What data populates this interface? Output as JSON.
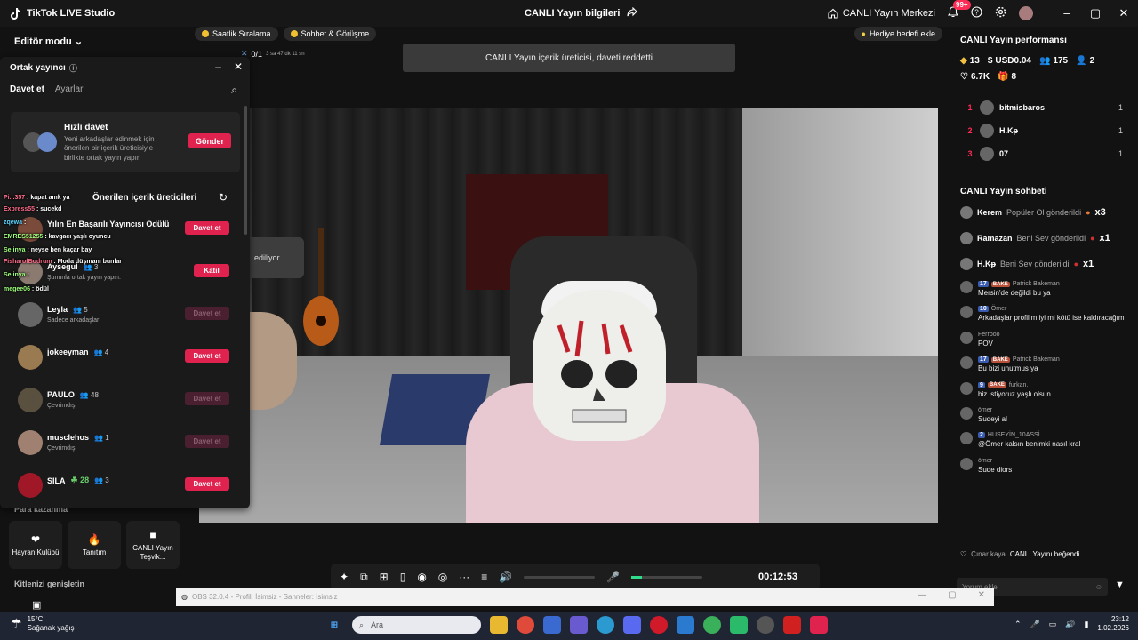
{
  "app": {
    "title": "TikTok LIVE Studio",
    "live_info_label": "CANLI Yayın bilgileri",
    "live_center_label": "CANLI Yayın Merkezi",
    "notif_badge": "99+"
  },
  "left": {
    "editor_mode": "Editör modu",
    "monetize_title": "Para kazanma",
    "tiles": [
      {
        "label": "Hayran Kulübü"
      },
      {
        "label": "Tanıtım"
      },
      {
        "label": "CANLI Yayın Teşvik..."
      }
    ],
    "grow_title": "Kitlenizi genişletin"
  },
  "center": {
    "chips": [
      "Saatlik Sıralama",
      "Sohbet & Görüşme"
    ],
    "goal_chip": "Hediye hedefi ekle",
    "timer_count": "0/1",
    "timer_small": "3 sa 47 dk 11 sn",
    "toast": "CANLI Yayın içerik üreticisi, daveti reddetti",
    "connecting": "ediliyor ...",
    "elapsed": "00:12:53"
  },
  "cohost": {
    "title": "Ortak yayıncı",
    "tabs": {
      "active": "Davet et",
      "inactive": "Ayarlar"
    },
    "quick_title": "Hızlı davet",
    "quick_desc": "Yeni arkadaşlar edinmek için önerilen bir içerik üreticisiyle birlikte ortak yayın yapın",
    "quick_button": "Gönder",
    "suggested_title": "Önerilen içerik üreticileri",
    "rows": [
      {
        "name": "Yılın En Başarılı Yayıncısı Ödülü",
        "count": "",
        "sub": "",
        "button": "Davet et",
        "disabled": false,
        "color": "#7a4a3a"
      },
      {
        "name": "Aysegul",
        "count": "3",
        "sub": "Şununla ortak yayın yapın:",
        "button": "Katıl",
        "disabled": false,
        "color": "#8a7a70"
      },
      {
        "name": "Leyla",
        "count": "5",
        "sub": "Sadece arkadaşlar",
        "button": "Davet et",
        "disabled": true,
        "color": "#666"
      },
      {
        "name": "jokeeyman",
        "count": "4",
        "sub": "",
        "button": "Davet et",
        "disabled": false,
        "color": "#9a7a50"
      },
      {
        "name": "PAULO",
        "count": "48",
        "sub": "Çevrimdışı",
        "button": "Davet et",
        "disabled": true,
        "color": "#5a5040"
      },
      {
        "name": "musclehos",
        "count": "1",
        "sub": "Çevrimdışı",
        "button": "Davet et",
        "disabled": true,
        "color": "#a08070"
      },
      {
        "name": "SILA",
        "count": "3",
        "sub": "",
        "button": "Davet et",
        "disabled": false,
        "color": "#a01828",
        "extra": "☘ 28"
      }
    ]
  },
  "overlay_chat": [
    {
      "user": "Pi...357",
      "text": ": kapat amk ya",
      "color": "#ff6b8a"
    },
    {
      "user": "Express55",
      "text": ": sucekd",
      "color": "#ff6b8a"
    },
    {
      "user": "zqewa",
      "text": ":",
      "color": "#5bd4ff"
    },
    {
      "user": "EMRES51255",
      "text": ": kavgacı yaşlı oyuncu",
      "color": "#9dff7a"
    },
    {
      "user": "Selinya",
      "text": ": neyse ben kaçar bay",
      "color": "#9dff7a"
    },
    {
      "user": "FisharofBodrum",
      "text": ": Moda düşmanı bunlar",
      "color": "#ff6b8a"
    },
    {
      "user": "Selinya",
      "text": ":",
      "color": "#9dff7a"
    },
    {
      "user": "megee06",
      "text": ": ödül",
      "color": "#9dff7a"
    }
  ],
  "right": {
    "perf_title": "CANLI Yayın performansı",
    "stats": [
      {
        "icon": "diamond",
        "value": "13"
      },
      {
        "icon": "dollar",
        "value": "USD0.04"
      },
      {
        "icon": "users",
        "value": "175"
      },
      {
        "icon": "user-plus",
        "value": "2"
      },
      {
        "icon": "heart",
        "value": "6.7K"
      },
      {
        "icon": "gift",
        "value": "8"
      }
    ],
    "ranking": [
      {
        "rank": "1",
        "name": "bitmisbaros",
        "score": "1"
      },
      {
        "rank": "2",
        "name": "H.Kᵽ",
        "score": "1"
      },
      {
        "rank": "3",
        "name": "07",
        "score": "1"
      }
    ],
    "chat_title": "CANLI Yayın sohbeti",
    "gifts": [
      {
        "user": "Kerem",
        "action": "Popüler Ol gönderildi",
        "mult": "x3"
      },
      {
        "user": "Ramazan",
        "action": "Beni Sev gönderildi",
        "mult": "x1"
      },
      {
        "user": "H.Kᵽ",
        "action": "Beni Sev gönderildi",
        "mult": "x1"
      }
    ],
    "messages": [
      {
        "lvl": "17",
        "fan": "BAKE",
        "user": "Patrick Bakeman",
        "text": "Mersin'de değildi bu ya"
      },
      {
        "lvl": "10",
        "fan": "",
        "user": "Ömer",
        "text": "Arkadaşlar profilim iyi mi kötü ise kaldıracağım"
      },
      {
        "lvl": "",
        "fan": "",
        "user": "Ferrooo",
        "text": "POV"
      },
      {
        "lvl": "17",
        "fan": "BAKE",
        "user": "Patrick Bakeman",
        "text": "Bu bizi unutmus ya"
      },
      {
        "lvl": "9",
        "fan": "BAKE",
        "user": "furkan.",
        "text": "biz istiyoruz yaşlı olsun"
      },
      {
        "lvl": "",
        "fan": "",
        "user": "ömer",
        "text": "Sudeyi al"
      },
      {
        "lvl": "2",
        "fan": "",
        "user": "HUSEYİN_10ASSİ",
        "text": "@Ömer kalsın benimki nasıl kral"
      },
      {
        "lvl": "",
        "fan": "",
        "user": "ömer",
        "text": "Sude diors"
      }
    ],
    "like_user": "Çınar kaya",
    "like_text": "CANLI Yayını beğendi",
    "comment_placeholder": "Yorum ekle"
  },
  "obs": {
    "text": "OBS 32.0.4 - Profil: İsimsiz - Sahneler: İsimsiz"
  },
  "taskbar": {
    "temp": "15°C",
    "weather": "Sağanak yağış",
    "search": "Ara",
    "time": "23:12",
    "date": "1.02.2026"
  }
}
